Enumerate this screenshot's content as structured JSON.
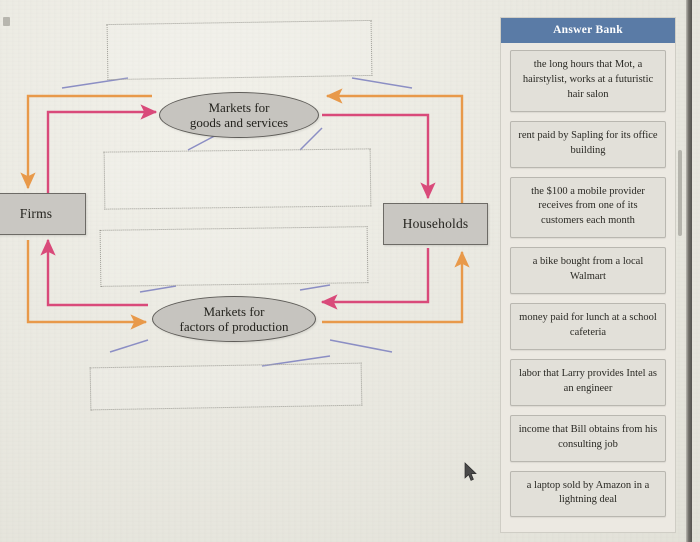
{
  "diagram": {
    "nodes": {
      "firms": "Firms",
      "households": "Households",
      "markets_goods_line1": "Markets for",
      "markets_goods_line2": "goods and services",
      "markets_factors_line1": "Markets for",
      "markets_factors_line2": "factors of production"
    },
    "drop_zones": [
      {
        "id": "drop-zone-1",
        "value": ""
      },
      {
        "id": "drop-zone-2",
        "value": ""
      },
      {
        "id": "drop-zone-3",
        "value": ""
      },
      {
        "id": "drop-zone-4",
        "value": ""
      }
    ],
    "colors": {
      "outer_flow": "#e8994a",
      "inner_flow": "#d94a7a",
      "leader_line": "#8b8ec4",
      "node_fill": "#c9c7c2",
      "node_border": "#6d6b66"
    }
  },
  "answer_bank": {
    "title": "Answer Bank",
    "header_color": "#5a7ba6",
    "items": [
      "the long hours that Mot, a hairstylist, works at a futuristic hair salon",
      "rent paid by Sapling for its office building",
      "the $100 a mobile provider receives from one of its customers each month",
      "a bike bought from a local Walmart",
      "money paid for lunch at a school cafeteria",
      "labor that Larry provides Intel as an engineer",
      "income that Bill obtains from his consulting job",
      "a laptop sold by Amazon in a lightning deal"
    ]
  }
}
